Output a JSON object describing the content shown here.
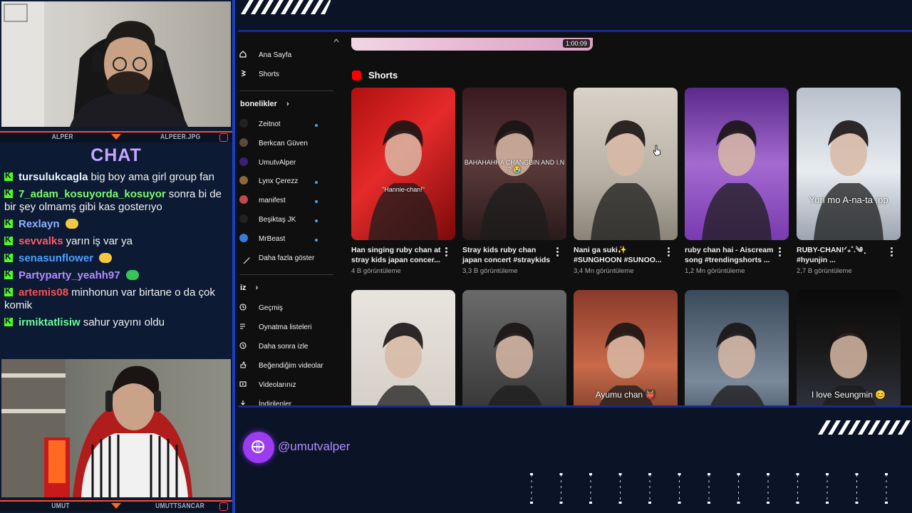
{
  "streamers": [
    {
      "name": "ALPER",
      "tag": "ALPEER.JPG"
    },
    {
      "name": "UMUT",
      "tag": "UMUTTSANCAR"
    }
  ],
  "chat": {
    "title": "CHAT",
    "messages": [
      {
        "user": "tursulukcagla",
        "color": "#e8f4ff",
        "text": "big boy ama girl group fan"
      },
      {
        "user": "7_adam_kosuyorda_kosuyor",
        "color": "#7cfc6a",
        "text": "sonra bi de bir şey olmamş gibi kas gosterıyo"
      },
      {
        "user": "Rexlayn",
        "color": "#8fb3ff",
        "text": "",
        "emote": "#f5c842"
      },
      {
        "user": "sevvalks",
        "color": "#ff5a66",
        "text": "yarın iş var ya"
      },
      {
        "user": "senasunflower",
        "color": "#4f9dff",
        "text": "",
        "emote": "#f5c842"
      },
      {
        "user": "Partyparty_yeahh97",
        "color": "#b48cff",
        "text": "",
        "emote": "#36c45a"
      },
      {
        "user": "artemis08",
        "color": "#ff4f4f",
        "text": "minhonun var birtane o da çok komik"
      },
      {
        "user": "irmiktatlisiw",
        "color": "#6dfc9c",
        "text": "sahur yayını oldu"
      }
    ]
  },
  "youtube": {
    "sidebar": {
      "top": [
        {
          "label": "Ana Sayfa",
          "icon": "home-icon"
        },
        {
          "label": "Shorts",
          "icon": "shorts-icon"
        }
      ],
      "subscriptions_header": "bonelikler",
      "subscriptions": [
        {
          "label": "Zeitnot",
          "dot": true,
          "color": "#222"
        },
        {
          "label": "Berkcan Güven",
          "dot": false,
          "color": "#5a4a3a"
        },
        {
          "label": "UmutvAlper",
          "dot": false,
          "color": "#3b1f7a"
        },
        {
          "label": "Lynx Çerezz",
          "dot": true,
          "color": "#8a6a3a"
        },
        {
          "label": "manifest",
          "dot": true,
          "color": "#c04a4a"
        },
        {
          "label": "Beşiktaş JK",
          "dot": true,
          "color": "#222"
        },
        {
          "label": "MrBeast",
          "dot": true,
          "color": "#3a7ad8"
        },
        {
          "label": "Daha fazla göster",
          "dot": false,
          "color": "none"
        }
      ],
      "you_header": "iz",
      "you": [
        {
          "label": "Geçmiş",
          "icon": "history-icon"
        },
        {
          "label": "Oynatma listeleri",
          "icon": "playlist-icon"
        },
        {
          "label": "Daha sonra izle",
          "icon": "watch-later-icon"
        },
        {
          "label": "Beğendiğim videolar",
          "icon": "like-icon"
        },
        {
          "label": "Videolarınız",
          "icon": "your-videos-icon"
        },
        {
          "label": "İndirilenler",
          "icon": "download-icon"
        }
      ]
    },
    "video_duration": "1:00:09",
    "shorts_title": "Shorts",
    "shorts_row1": [
      {
        "title": "Han singing ruby chan at stray kids japan concer...",
        "views": "4 B görüntüleme",
        "overlay": "\"Hannie-chan!\"",
        "bg": "linear-gradient(135deg,#b01010,#e52a2a 45%,#7a0a0a)"
      },
      {
        "title": "Stray kids ruby chan japan concert #straykids",
        "views": "3,3 B görüntüleme",
        "overlay": "BAHAHAHHA CHANGBIN AND I.N ? 😭",
        "bg": "linear-gradient(180deg,#3a1a20,#5a3a3a 50%,#2a1a1a)"
      },
      {
        "title": "Nani ga suki✨ #SUNGHOON #SUNOO...",
        "views": "3,4 Mn görüntüleme",
        "overlay": "",
        "bg": "linear-gradient(180deg,#d8d2c8,#b8b0a4 60%,#8a8478)"
      },
      {
        "title": "ruby chan hai - Aiscream song #trendingshorts ...",
        "views": "1,2 Mn görüntüleme",
        "overlay": "",
        "bg": "linear-gradient(180deg,#5a2a8a,#a46ad0 50%,#7a3ab0)"
      },
      {
        "title": "RUBY-CHAN!ᐟ₊˚.༄ ̥͙ #hyunjin ...",
        "views": "2,7 B görüntüleme",
        "overlay": "Yuri mo A-na-ta ;pp",
        "bg": "linear-gradient(180deg,#b8c0cc,#e8ecf0 55%,#9aa4b0)"
      }
    ],
    "shorts_row2": [
      {
        "overlay": "",
        "bg": "linear-gradient(180deg,#e8e4de,#cfc9c0)"
      },
      {
        "overlay": "",
        "bg": "linear-gradient(180deg,#6a6a6a,#2a2a2a)"
      },
      {
        "overlay": "Ayumu chan 👹",
        "bg": "linear-gradient(180deg,#8a3a2a,#c86a4a 50%,#5a2a1a)"
      },
      {
        "overlay": "",
        "bg": "linear-gradient(180deg,#3a4a5a,#7a8a9a 60%,#2a3a4a)"
      },
      {
        "overlay": "I love Seungmin 😊",
        "bg": "linear-gradient(180deg,#0a0a0a,#1a1a1a 40%,#3a4050)"
      }
    ]
  },
  "handle": "@umutvalper",
  "colors": {
    "accent": "#1b3fbf",
    "purple": "#9a3cf0",
    "kick": "#53fc18"
  }
}
